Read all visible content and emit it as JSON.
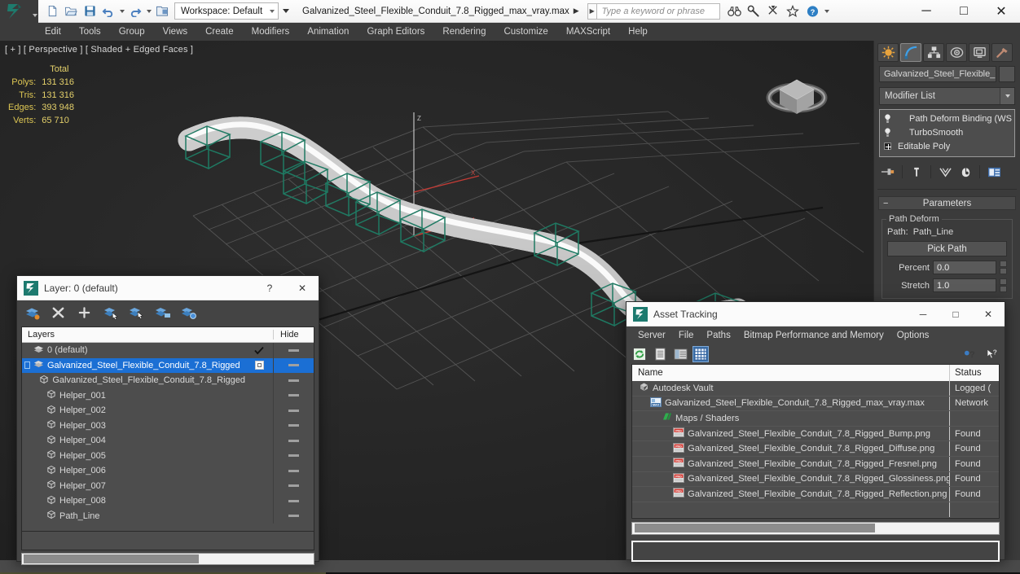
{
  "titlebar": {
    "workspace_label": "Workspace: Default",
    "file_title": "Galvanized_Steel_Flexible_Conduit_7.8_Rigged_max_vray.max",
    "search_placeholder": "Type a keyword or phrase",
    "quick_access": [
      {
        "name": "new-file-icon",
        "label": "New"
      },
      {
        "name": "open-file-icon",
        "label": "Open"
      },
      {
        "name": "save-file-icon",
        "label": "Save"
      },
      {
        "name": "undo-icon",
        "label": "Undo"
      },
      {
        "name": "redo-icon",
        "label": "Redo"
      },
      {
        "name": "project-folder-icon",
        "label": "Set Project Folder"
      }
    ],
    "help_icons": [
      {
        "name": "binoculars-icon",
        "label": "Search"
      },
      {
        "name": "wrench-icon",
        "label": "Tools"
      },
      {
        "name": "pencil-icon",
        "label": "Annotate"
      },
      {
        "name": "star-icon",
        "label": "Favorites"
      },
      {
        "name": "help-icon",
        "label": "Help"
      }
    ],
    "window_controls": {
      "minimize": "─",
      "maximize": "□",
      "close": "✕"
    }
  },
  "menubar": {
    "items": [
      "Edit",
      "Tools",
      "Group",
      "Views",
      "Create",
      "Modifiers",
      "Animation",
      "Graph Editors",
      "Rendering",
      "Customize",
      "MAXScript",
      "Help"
    ]
  },
  "viewport": {
    "label": "[ + ] [ Perspective ] [ Shaded + Edged Faces ]",
    "stats_header": "Total",
    "stats": [
      {
        "label": "Polys:",
        "value": "131 316"
      },
      {
        "label": "Tris:",
        "value": "131 316"
      },
      {
        "label": "Edges:",
        "value": "393 948"
      },
      {
        "label": "Verts:",
        "value": "65 710"
      }
    ],
    "colors": {
      "background": "#262626",
      "grid": "#5a5a5a",
      "helper_box": "#1f7a63",
      "axis_x": "#c23b35",
      "mesh": "#f2f2f2"
    },
    "axis_labels": {
      "x": "X",
      "z": "Z"
    },
    "viewcube_name": "view-cube"
  },
  "command_panel": {
    "tabs": [
      {
        "name": "create-tab",
        "label": "Create",
        "active": false
      },
      {
        "name": "modify-tab",
        "label": "Modify",
        "active": true
      },
      {
        "name": "hierarchy-tab",
        "label": "Hierarchy",
        "active": false
      },
      {
        "name": "motion-tab",
        "label": "Motion",
        "active": false
      },
      {
        "name": "display-tab",
        "label": "Display",
        "active": false
      },
      {
        "name": "utilities-tab",
        "label": "Utilities",
        "active": false
      }
    ],
    "object_name": "Galvanized_Steel_Flexible_Condi",
    "modifier_list_label": "Modifier List",
    "modifier_stack": [
      {
        "label": "Path Deform Binding (WS",
        "icon": "lightbulb-icon"
      },
      {
        "label": "TurboSmooth",
        "icon": "lightbulb-icon"
      },
      {
        "label": "Editable Poly",
        "icon": "plus-box-icon"
      }
    ],
    "stack_tools": [
      {
        "name": "pin-stack-icon",
        "label": "Pin Stack"
      },
      {
        "name": "show-end-result-icon",
        "label": "Show End Result"
      },
      {
        "name": "make-unique-icon",
        "label": "Make Unique"
      },
      {
        "name": "remove-modifier-icon",
        "label": "Remove Modifier"
      },
      {
        "name": "configure-sets-icon",
        "label": "Configure Modifier Sets"
      }
    ],
    "rollout": {
      "title": "Parameters",
      "group_title": "Path Deform",
      "path_label": "Path:",
      "path_value": "Path_Line",
      "pick_path_label": "Pick Path",
      "percent_label": "Percent",
      "percent_value": "0.0",
      "stretch_label": "Stretch",
      "stretch_value": "1.0"
    }
  },
  "layer_dialog": {
    "title": "Layer: 0 (default)",
    "help_glyph": "?",
    "close_glyph": "✕",
    "toolbar": [
      {
        "name": "create-new-layer-icon",
        "label": "Create New Layer"
      },
      {
        "name": "delete-layer-icon",
        "label": "Delete Highlighted Empty Layers"
      },
      {
        "name": "add-selection-icon",
        "label": "Add Selected Objects to Highlighted Layer"
      },
      {
        "name": "select-objects-in-layer-icon",
        "label": "Select Objects in Highlighted Layers"
      },
      {
        "name": "highlight-selected-icon",
        "label": "Highlight Selected Objects Layers"
      },
      {
        "name": "hide-layer-icon",
        "label": "Hide/Unhide Layers"
      },
      {
        "name": "layer-settings-icon",
        "label": "Layer Settings"
      }
    ],
    "columns": {
      "name": "Layers",
      "hide": "Hide"
    },
    "rows": [
      {
        "label": "0 (default)",
        "indent": 0,
        "selected": false,
        "current": true,
        "icon": "layer-icon",
        "hide_dash": true
      },
      {
        "label": "Galvanized_Steel_Flexible_Conduit_7.8_Rigged",
        "indent": 0,
        "selected": true,
        "current": false,
        "icon": "layer-icon",
        "expander": true,
        "checkbox": true,
        "hide_dash": true
      },
      {
        "label": "Galvanized_Steel_Flexible_Conduit_7.8_Rigged",
        "indent": 1,
        "selected": false,
        "current": false,
        "icon": "object-icon",
        "hide_dash": true
      },
      {
        "label": "Helper_001",
        "indent": 1,
        "selected": false,
        "current": false,
        "icon": "object-icon",
        "hide_dash": true
      },
      {
        "label": "Helper_002",
        "indent": 1,
        "selected": false,
        "current": false,
        "icon": "object-icon",
        "hide_dash": true
      },
      {
        "label": "Helper_003",
        "indent": 1,
        "selected": false,
        "current": false,
        "icon": "object-icon",
        "hide_dash": true
      },
      {
        "label": "Helper_004",
        "indent": 1,
        "selected": false,
        "current": false,
        "icon": "object-icon",
        "hide_dash": true
      },
      {
        "label": "Helper_005",
        "indent": 1,
        "selected": false,
        "current": false,
        "icon": "object-icon",
        "hide_dash": true
      },
      {
        "label": "Helper_006",
        "indent": 1,
        "selected": false,
        "current": false,
        "icon": "object-icon",
        "hide_dash": true
      },
      {
        "label": "Helper_007",
        "indent": 1,
        "selected": false,
        "current": false,
        "icon": "object-icon",
        "hide_dash": true
      },
      {
        "label": "Helper_008",
        "indent": 1,
        "selected": false,
        "current": false,
        "icon": "object-icon",
        "hide_dash": true
      },
      {
        "label": "Path_Line",
        "indent": 1,
        "selected": false,
        "current": false,
        "icon": "object-icon",
        "hide_dash": true
      }
    ],
    "selection_color": "#1b6fd4"
  },
  "asset_dialog": {
    "title": "Asset Tracking",
    "window_controls": {
      "minimize": "─",
      "maximize": "□",
      "close": "✕"
    },
    "menu": [
      "Server",
      "File",
      "Paths",
      "Bitmap Performance and Memory",
      "Options"
    ],
    "toolbar": [
      {
        "name": "refresh-icon",
        "label": "Refresh"
      },
      {
        "name": "list-view-icon",
        "label": "List View"
      },
      {
        "name": "details-view-icon",
        "label": "Details View"
      },
      {
        "name": "grid-view-icon",
        "label": "Grid View",
        "active": true
      }
    ],
    "toolbar_right": [
      {
        "name": "help-asset-icon",
        "label": "Help"
      },
      {
        "name": "context-help-icon",
        "label": "Context Help"
      }
    ],
    "columns": {
      "name": "Name",
      "status": "Status"
    },
    "rows": [
      {
        "label": "Autodesk Vault",
        "status": "Logged (",
        "indent": 0,
        "icon": "vault-icon"
      },
      {
        "label": "Galvanized_Steel_Flexible_Conduit_7.8_Rigged_max_vray.max",
        "status": "Network",
        "indent": 1,
        "icon": "max-file-icon"
      },
      {
        "label": "Maps / Shaders",
        "status": "",
        "indent": 2,
        "icon": "maps-shaders-icon"
      },
      {
        "label": "Galvanized_Steel_Flexible_Conduit_7.8_Rigged_Bump.png",
        "status": "Found",
        "indent": 3,
        "icon": "png-icon"
      },
      {
        "label": "Galvanized_Steel_Flexible_Conduit_7.8_Rigged_Diffuse.png",
        "status": "Found",
        "indent": 3,
        "icon": "png-icon"
      },
      {
        "label": "Galvanized_Steel_Flexible_Conduit_7.8_Rigged_Fresnel.png",
        "status": "Found",
        "indent": 3,
        "icon": "png-icon"
      },
      {
        "label": "Galvanized_Steel_Flexible_Conduit_7.8_Rigged_Glossiness.png",
        "status": "Found",
        "indent": 3,
        "icon": "png-icon"
      },
      {
        "label": "Galvanized_Steel_Flexible_Conduit_7.8_Rigged_Reflection.png",
        "status": "Found",
        "indent": 3,
        "icon": "png-icon"
      }
    ]
  }
}
